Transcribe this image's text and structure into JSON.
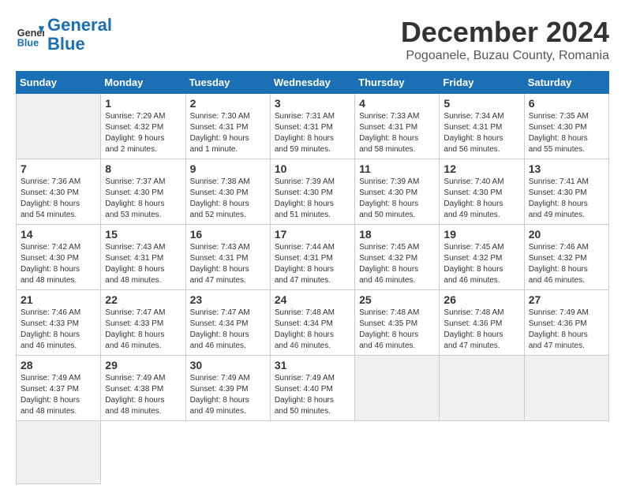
{
  "header": {
    "logo_line1": "General",
    "logo_line2": "Blue",
    "title": "December 2024",
    "subtitle": "Pogoanele, Buzau County, Romania"
  },
  "weekdays": [
    "Sunday",
    "Monday",
    "Tuesday",
    "Wednesday",
    "Thursday",
    "Friday",
    "Saturday"
  ],
  "days": [
    {
      "num": "",
      "info": ""
    },
    {
      "num": "1",
      "info": "Sunrise: 7:29 AM\nSunset: 4:32 PM\nDaylight: 9 hours\nand 2 minutes."
    },
    {
      "num": "2",
      "info": "Sunrise: 7:30 AM\nSunset: 4:31 PM\nDaylight: 9 hours\nand 1 minute."
    },
    {
      "num": "3",
      "info": "Sunrise: 7:31 AM\nSunset: 4:31 PM\nDaylight: 8 hours\nand 59 minutes."
    },
    {
      "num": "4",
      "info": "Sunrise: 7:33 AM\nSunset: 4:31 PM\nDaylight: 8 hours\nand 58 minutes."
    },
    {
      "num": "5",
      "info": "Sunrise: 7:34 AM\nSunset: 4:31 PM\nDaylight: 8 hours\nand 56 minutes."
    },
    {
      "num": "6",
      "info": "Sunrise: 7:35 AM\nSunset: 4:30 PM\nDaylight: 8 hours\nand 55 minutes."
    },
    {
      "num": "7",
      "info": "Sunrise: 7:36 AM\nSunset: 4:30 PM\nDaylight: 8 hours\nand 54 minutes."
    },
    {
      "num": "8",
      "info": "Sunrise: 7:37 AM\nSunset: 4:30 PM\nDaylight: 8 hours\nand 53 minutes."
    },
    {
      "num": "9",
      "info": "Sunrise: 7:38 AM\nSunset: 4:30 PM\nDaylight: 8 hours\nand 52 minutes."
    },
    {
      "num": "10",
      "info": "Sunrise: 7:39 AM\nSunset: 4:30 PM\nDaylight: 8 hours\nand 51 minutes."
    },
    {
      "num": "11",
      "info": "Sunrise: 7:39 AM\nSunset: 4:30 PM\nDaylight: 8 hours\nand 50 minutes."
    },
    {
      "num": "12",
      "info": "Sunrise: 7:40 AM\nSunset: 4:30 PM\nDaylight: 8 hours\nand 49 minutes."
    },
    {
      "num": "13",
      "info": "Sunrise: 7:41 AM\nSunset: 4:30 PM\nDaylight: 8 hours\nand 49 minutes."
    },
    {
      "num": "14",
      "info": "Sunrise: 7:42 AM\nSunset: 4:30 PM\nDaylight: 8 hours\nand 48 minutes."
    },
    {
      "num": "15",
      "info": "Sunrise: 7:43 AM\nSunset: 4:31 PM\nDaylight: 8 hours\nand 48 minutes."
    },
    {
      "num": "16",
      "info": "Sunrise: 7:43 AM\nSunset: 4:31 PM\nDaylight: 8 hours\nand 47 minutes."
    },
    {
      "num": "17",
      "info": "Sunrise: 7:44 AM\nSunset: 4:31 PM\nDaylight: 8 hours\nand 47 minutes."
    },
    {
      "num": "18",
      "info": "Sunrise: 7:45 AM\nSunset: 4:32 PM\nDaylight: 8 hours\nand 46 minutes."
    },
    {
      "num": "19",
      "info": "Sunrise: 7:45 AM\nSunset: 4:32 PM\nDaylight: 8 hours\nand 46 minutes."
    },
    {
      "num": "20",
      "info": "Sunrise: 7:46 AM\nSunset: 4:32 PM\nDaylight: 8 hours\nand 46 minutes."
    },
    {
      "num": "21",
      "info": "Sunrise: 7:46 AM\nSunset: 4:33 PM\nDaylight: 8 hours\nand 46 minutes."
    },
    {
      "num": "22",
      "info": "Sunrise: 7:47 AM\nSunset: 4:33 PM\nDaylight: 8 hours\nand 46 minutes."
    },
    {
      "num": "23",
      "info": "Sunrise: 7:47 AM\nSunset: 4:34 PM\nDaylight: 8 hours\nand 46 minutes."
    },
    {
      "num": "24",
      "info": "Sunrise: 7:48 AM\nSunset: 4:34 PM\nDaylight: 8 hours\nand 46 minutes."
    },
    {
      "num": "25",
      "info": "Sunrise: 7:48 AM\nSunset: 4:35 PM\nDaylight: 8 hours\nand 46 minutes."
    },
    {
      "num": "26",
      "info": "Sunrise: 7:48 AM\nSunset: 4:36 PM\nDaylight: 8 hours\nand 47 minutes."
    },
    {
      "num": "27",
      "info": "Sunrise: 7:49 AM\nSunset: 4:36 PM\nDaylight: 8 hours\nand 47 minutes."
    },
    {
      "num": "28",
      "info": "Sunrise: 7:49 AM\nSunset: 4:37 PM\nDaylight: 8 hours\nand 48 minutes."
    },
    {
      "num": "29",
      "info": "Sunrise: 7:49 AM\nSunset: 4:38 PM\nDaylight: 8 hours\nand 48 minutes."
    },
    {
      "num": "30",
      "info": "Sunrise: 7:49 AM\nSunset: 4:39 PM\nDaylight: 8 hours\nand 49 minutes."
    },
    {
      "num": "31",
      "info": "Sunrise: 7:49 AM\nSunset: 4:40 PM\nDaylight: 8 hours\nand 50 minutes."
    },
    {
      "num": "",
      "info": ""
    },
    {
      "num": "",
      "info": ""
    },
    {
      "num": "",
      "info": ""
    },
    {
      "num": "",
      "info": ""
    }
  ]
}
